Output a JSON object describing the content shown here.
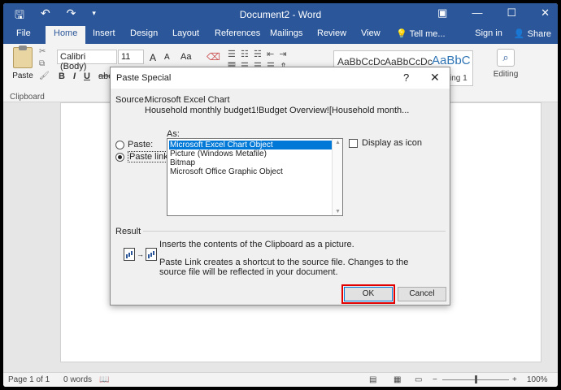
{
  "window": {
    "title": "Document2 - Word",
    "qat_icons": [
      "save-icon",
      "undo-icon",
      "undo-dropdown-icon",
      "redo-icon",
      "customize-qat-icon"
    ],
    "controls": [
      "ribbon-display-icon",
      "minimize-icon",
      "restore-icon",
      "close-icon"
    ]
  },
  "tabs": {
    "file": "File",
    "home": "Home",
    "insert": "Insert",
    "design": "Design",
    "layout": "Layout",
    "references": "References",
    "mailings": "Mailings",
    "review": "Review",
    "view": "View",
    "tell_me": "Tell me...",
    "sign_in": "Sign in",
    "share": "Share"
  },
  "ribbon": {
    "paste": "Paste",
    "clipboard": "Clipboard",
    "font_name": "Calibri (Body)",
    "font_size": "11",
    "grow_font": "A",
    "shrink_font": "A",
    "change_case": "Aa",
    "bold": "B",
    "italic": "I",
    "underline": "U",
    "abc": "abc",
    "styles": [
      "AaBbCcDc",
      "AaBbCcDc",
      "AaBbC"
    ],
    "heading_partial": "ing 1",
    "editing": "Editing"
  },
  "dialog": {
    "title": "Paste Special",
    "help": "?",
    "close": "✕",
    "source_label": "Source:",
    "source_name": "Microsoft Excel Chart",
    "source_path": "Household monthly budget1!Budget Overview![Household month...",
    "paste_label": "Paste:",
    "paste_link_label": "Paste link:",
    "paste_mode": "paste_link",
    "as_label": "As:",
    "as_options": [
      "Microsoft Excel Chart Object",
      "Picture (Windows Metafile)",
      "Bitmap",
      "Microsoft Office Graphic Object"
    ],
    "as_selected": 0,
    "display_as_icon": "Display as icon",
    "display_as_icon_checked": false,
    "result_label": "Result",
    "result_text_1": "Inserts the contents of the Clipboard as a picture.",
    "result_text_2": "Paste Link creates a shortcut to the source file. Changes to the source file will be reflected in your document.",
    "ok": "OK",
    "cancel": "Cancel"
  },
  "status": {
    "page": "Page 1 of 1",
    "words": "0 words",
    "zoom": "100%",
    "zoom_minus": "−",
    "zoom_plus": "+"
  }
}
